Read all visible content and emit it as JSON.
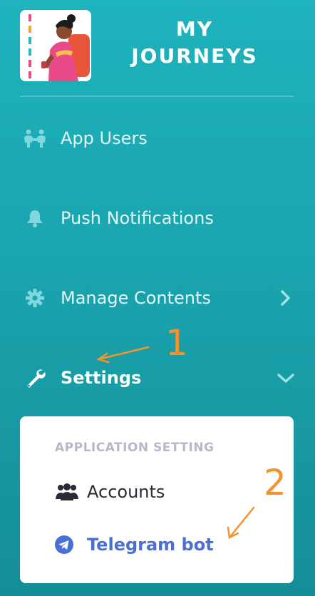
{
  "header": {
    "app_title": "MY JOURNEYS",
    "logo_icon": "traveler-illustration"
  },
  "sidebar": {
    "items": [
      {
        "label": "App Users",
        "icon": "users-icon"
      },
      {
        "label": "Push Notifications",
        "icon": "bell-icon"
      },
      {
        "label": "Manage Contents",
        "icon": "gear-icon"
      },
      {
        "label": "Settings",
        "icon": "wrench-icon"
      }
    ]
  },
  "submenu": {
    "heading": "APPLICATION SETTING",
    "items": [
      {
        "label": "Accounts",
        "icon": "accounts-icon"
      },
      {
        "label": "Telegram bot",
        "icon": "telegram-icon"
      }
    ]
  },
  "annotations": {
    "label_1": "1",
    "label_2": "2"
  },
  "colors": {
    "sidebar_bg": "#1aa4ae",
    "active_submenu": "#4c6fd6",
    "annotation": "#f4922d"
  }
}
